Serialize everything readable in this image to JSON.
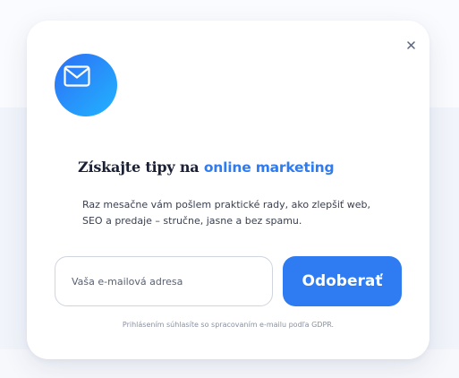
{
  "popup": {
    "close_label": "×",
    "icon": "mail-icon",
    "title": {
      "prefix": "Získajte tipy na ",
      "accent": "online marketing"
    },
    "description_line1": "Raz mesačne vám pošlem praktické rady, ako zlepšiť web,",
    "description_line2": "SEO a predaje – stručne, jasne a bez spamu.",
    "email_placeholder": "Vaša e-mailová adresa",
    "email_value": "",
    "subscribe_label": "Odoberať",
    "consent_text": "Prihlásením súhlasíte so spracovaním e-mailu podľa GDPR."
  },
  "colors": {
    "accent": "#2f7bf2",
    "icon_gradient_start": "#2d6ff5",
    "icon_gradient_end": "#22b3ff",
    "title_text": "#1b2035",
    "body_text": "#3a3f4f",
    "muted_text": "#8a90a0"
  }
}
